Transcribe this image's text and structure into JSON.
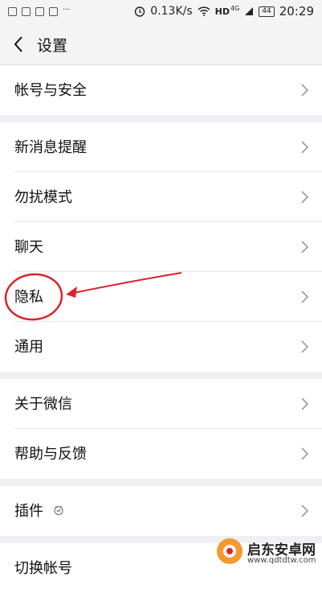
{
  "status_bar": {
    "network_speed": "0.13K/s",
    "network_type": "HD",
    "signal_label": "4G",
    "battery": "44",
    "time": "20:29"
  },
  "header": {
    "title": "设置",
    "back_icon": "chevron-left-icon"
  },
  "settings": {
    "items": [
      {
        "label": "帐号与安全"
      },
      {
        "label": "新消息提醒"
      },
      {
        "label": "勿扰模式"
      },
      {
        "label": "聊天"
      },
      {
        "label": "隐私"
      },
      {
        "label": "通用"
      },
      {
        "label": "关于微信"
      },
      {
        "label": "帮助与反馈"
      },
      {
        "label": "插件"
      },
      {
        "label": "切换帐号"
      }
    ]
  },
  "annotation": {
    "color": "#d9252b"
  },
  "watermark": {
    "name": "启东安卓网",
    "url": "www.qdtdtw.com"
  }
}
